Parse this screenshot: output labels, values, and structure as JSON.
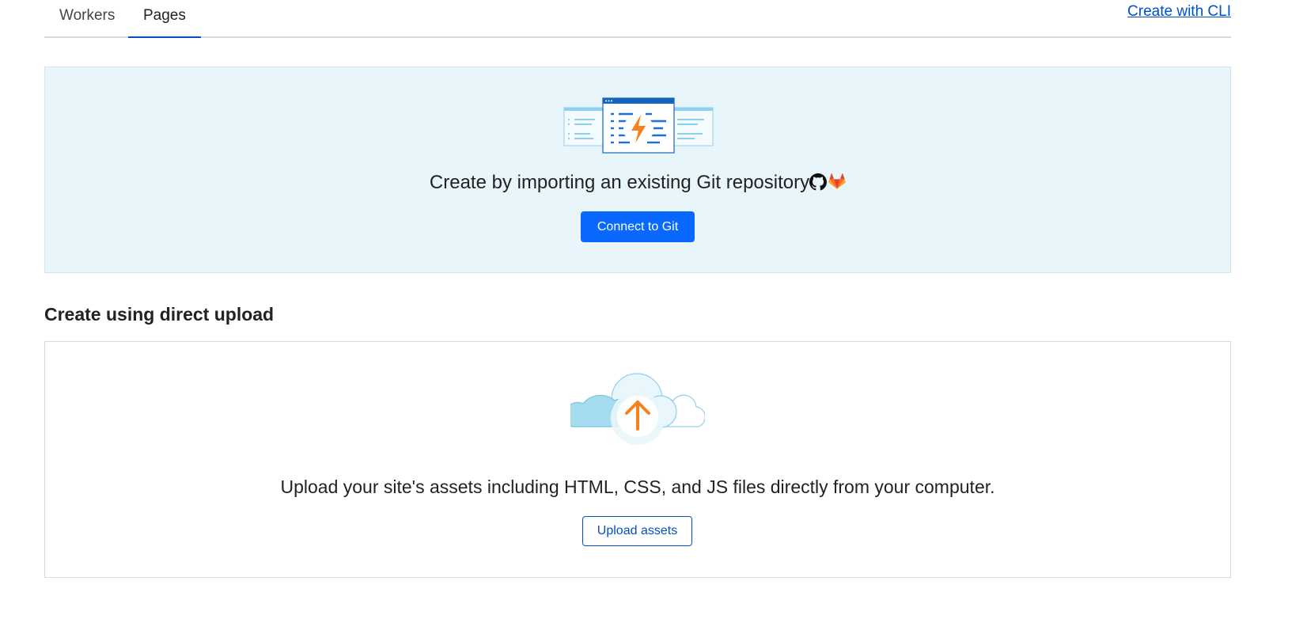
{
  "tabs": [
    {
      "label": "Workers",
      "active": false
    },
    {
      "label": "Pages",
      "active": true
    }
  ],
  "cli_link": "Create with CLI",
  "git_section": {
    "text": "Create by importing an existing Git repository",
    "providers": [
      "github-icon",
      "gitlab-icon"
    ],
    "button": "Connect to Git"
  },
  "upload_section": {
    "title": "Create using direct upload",
    "text": "Upload your site's assets including HTML, CSS, and JS files directly from your computer.",
    "button": "Upload assets"
  },
  "colors": {
    "accent": "#0051c3",
    "primary_button": "#0969ff",
    "git_panel_bg": "#e8f5fa",
    "orange": "#f6821f"
  }
}
